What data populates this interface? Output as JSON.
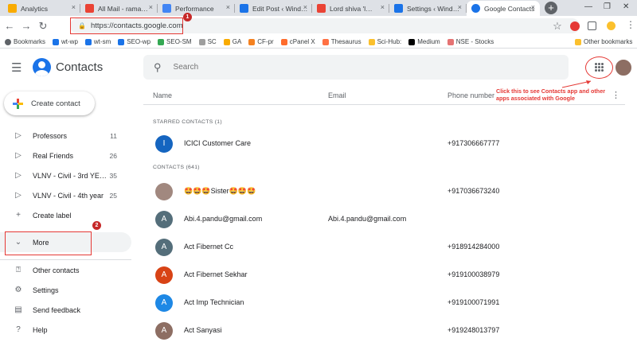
{
  "browser": {
    "tabs": [
      {
        "label": "Analytics",
        "color": "#f9ab00"
      },
      {
        "label": "All Mail - rama…",
        "color": "#ea4335"
      },
      {
        "label": "Performance",
        "color": "#4285f4"
      },
      {
        "label": "Edit Post ‹ Wind…",
        "color": "#1a73e8"
      },
      {
        "label": "Lord shiva 'l…",
        "color": "#ea4335"
      },
      {
        "label": "Settings ‹ Wind…",
        "color": "#1a73e8"
      },
      {
        "label": "Google Contacts",
        "color": "#1a73e8"
      }
    ],
    "url": "https://contacts.google.com",
    "bookmarks": [
      "Bookmarks",
      "wt-wp",
      "wt-sm",
      "SEO-wp",
      "SEO-SM",
      "SC",
      "GA",
      "CF-pr",
      "cPanel X",
      "Thesaurus",
      "Sci-Hub:",
      "Medium",
      "NSE - Stocks",
      "Other bookmarks"
    ]
  },
  "header": {
    "app_title": "Contacts",
    "search_placeholder": "Search"
  },
  "annotation": {
    "text": "Click this to see Contacts app and other apps associated with Google",
    "badge1": "1",
    "badge2": "2",
    "color": "#e53935"
  },
  "sidebar": {
    "create_label": "Create contact",
    "labels": [
      {
        "label": "Professors",
        "count": "11"
      },
      {
        "label": "Real Friends",
        "count": "26"
      },
      {
        "label": "VLNV - Civil - 3rd YE…",
        "count": "35"
      },
      {
        "label": "VLNV - Civil - 4th year",
        "count": "25"
      }
    ],
    "create_label_item": "Create label",
    "more": "More",
    "other_contacts": "Other contacts",
    "settings": "Settings",
    "send_feedback": "Send feedback",
    "help": "Help"
  },
  "table": {
    "col_name": "Name",
    "col_email": "Email",
    "col_phone": "Phone number",
    "starred_heading": "STARRED CONTACTS (1)",
    "contacts_heading": "CONTACTS (641)",
    "starred": [
      {
        "initial": "I",
        "name": "ICICI Customer Care",
        "email": "",
        "phone": "+917306667777",
        "color": "#1565c0"
      }
    ],
    "contacts": [
      {
        "initial": "",
        "name": "🤩🤩🤩Sister🤩🤩🤩",
        "email": "",
        "phone": "+917036673240",
        "color": "#a1887f"
      },
      {
        "initial": "A",
        "name": "Abi.4.pandu@gmail.com",
        "email": "Abi.4.pandu@gmail.com",
        "phone": "",
        "color": "#546e7a"
      },
      {
        "initial": "A",
        "name": "Act Fibernet Cc",
        "email": "",
        "phone": "+918914284000",
        "color": "#546e7a"
      },
      {
        "initial": "A",
        "name": "Act Fibernet Sekhar",
        "email": "",
        "phone": "+919100038979",
        "color": "#d84315"
      },
      {
        "initial": "A",
        "name": "Act Imp Technician",
        "email": "",
        "phone": "+919100071991",
        "color": "#1e88e5"
      },
      {
        "initial": "A",
        "name": "Act Sanyasi",
        "email": "",
        "phone": "+919248013797",
        "color": "#8d6e63"
      }
    ]
  }
}
